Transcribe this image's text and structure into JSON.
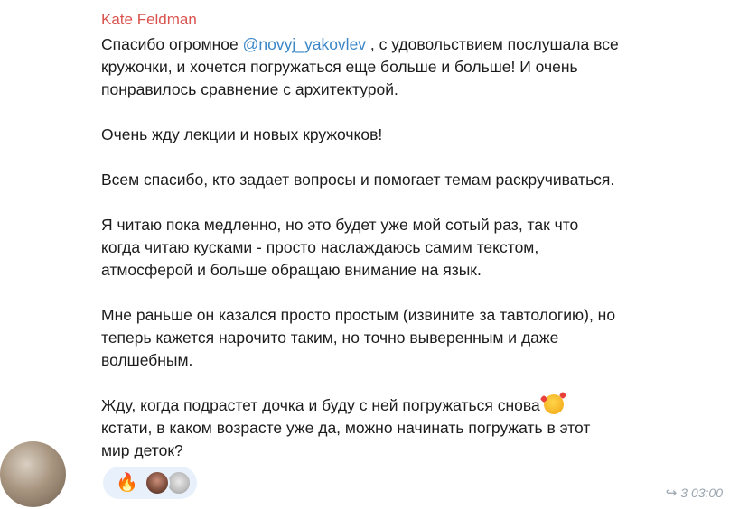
{
  "message": {
    "sender": "Kate Feldman",
    "paragraphs": [
      {
        "lines": [
          {
            "before": "Спасибо огромное ",
            "mention": "@novyj_yakovlev",
            "after": " , с удовольствием послушала все"
          },
          {
            "text": "кружочки, и хочется погружаться еще больше и больше! И очень"
          },
          {
            "text": "понравилось сравнение с архитектурой."
          }
        ]
      },
      {
        "lines": [
          {
            "text": "Очень жду лекции и новых кружочков!"
          }
        ]
      },
      {
        "lines": [
          {
            "text": "Всем спасибо, кто задает вопросы и помогает темам раскручиваться."
          }
        ]
      },
      {
        "lines": [
          {
            "text": "Я читаю пока медленно, но это будет уже мой сотый раз, так что"
          },
          {
            "text": "когда читаю кусками - просто наслаждаюсь самим текстом,"
          },
          {
            "text": "атмосферой и больше обращаю внимание на язык."
          }
        ]
      },
      {
        "lines": [
          {
            "text": "Мне раньше он казался просто простым (извините за тавтологию), но"
          },
          {
            "text": "теперь кажется нарочито таким, но точно выверенным и даже"
          },
          {
            "text": "волшебным."
          }
        ]
      },
      {
        "lines": [
          {
            "text": "Жду, когда подрастет дочка и буду с ней погружаться снова"
          },
          {
            "text": "кстати, в каком возрасте уже да, можно начинать погружать в этот"
          },
          {
            "text": "мир деток?"
          }
        ]
      }
    ],
    "emoji_icon": "smiling-face-with-hearts-icon",
    "reactions": {
      "emoji": "🔥",
      "reactor_avatars": [
        "reactor-avatar-1",
        "reactor-avatar-2"
      ]
    },
    "meta": {
      "share_icon": "↪",
      "time": "3 03:00"
    }
  }
}
